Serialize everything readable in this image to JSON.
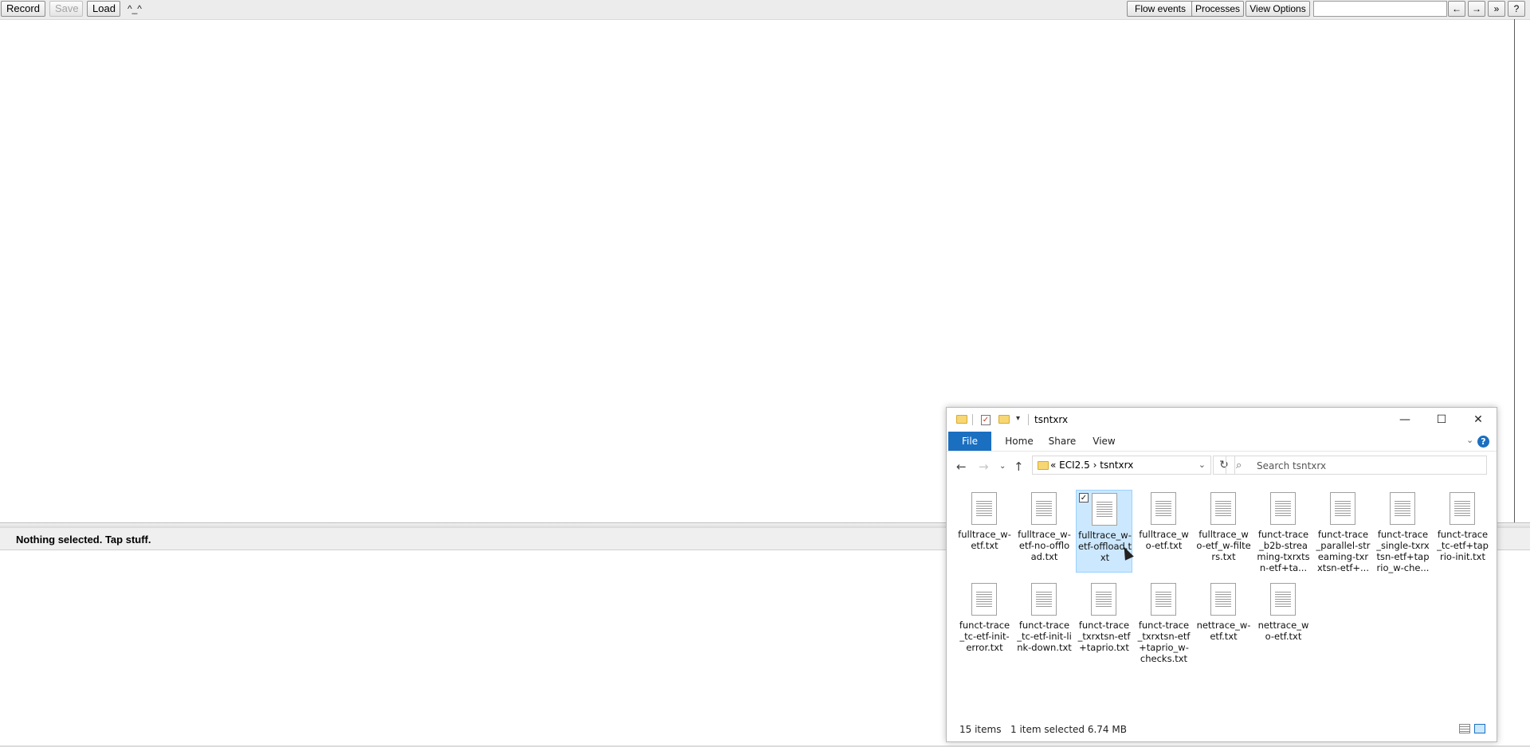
{
  "toolbar": {
    "record": "Record",
    "save": "Save",
    "load": "Load",
    "caret": "^_^",
    "flow_events": "Flow events",
    "processes": "Processes",
    "view_options": "View Options",
    "prev": "←",
    "next": "→",
    "more": "»",
    "help": "?"
  },
  "status": {
    "text": "Nothing selected. Tap stuff."
  },
  "explorer": {
    "title": "tsntxrx",
    "ribbon_tabs": [
      "File",
      "Home",
      "Share",
      "View"
    ],
    "help": "?",
    "address": {
      "prefix": "«",
      "parent": "ECI2.5",
      "separator": "›",
      "current": "tsntxrx"
    },
    "search_placeholder": "Search tsntxrx",
    "files": [
      {
        "name": "fulltrace_w-etf.txt",
        "selected": false
      },
      {
        "name": "fulltrace_w-etf-no-offload.txt",
        "selected": false
      },
      {
        "name": "fulltrace_w-etf-offload.txt",
        "selected": true
      },
      {
        "name": "fulltrace_wo-etf.txt",
        "selected": false
      },
      {
        "name": "fulltrace_wo-etf_w-filters.txt",
        "selected": false
      },
      {
        "name": "funct-trace_b2b-streaming-txrxtsn-etf+ta...",
        "selected": false
      },
      {
        "name": "funct-trace_parallel-streaming-txrxtsn-etf+...",
        "selected": false
      },
      {
        "name": "funct-trace_single-txrxtsn-etf+taprio_w-che...",
        "selected": false
      },
      {
        "name": "funct-trace_tc-etf+taprio-init.txt",
        "selected": false
      },
      {
        "name": "funct-trace_tc-etf-init-error.txt",
        "selected": false
      },
      {
        "name": "funct-trace_tc-etf-init-link-down.txt",
        "selected": false
      },
      {
        "name": "funct-trace_txrxtsn-etf+taprio.txt",
        "selected": false
      },
      {
        "name": "funct-trace_txrxtsn-etf+taprio_w-checks.txt",
        "selected": false
      },
      {
        "name": "nettrace_w-etf.txt",
        "selected": false
      },
      {
        "name": "nettrace_wo-etf.txt",
        "selected": false
      }
    ],
    "item_count": "15 items",
    "selection_info": "1 item selected  6.74 MB"
  },
  "colors": {
    "accent": "#1a6fc1",
    "selection_bg": "#cce8ff"
  }
}
